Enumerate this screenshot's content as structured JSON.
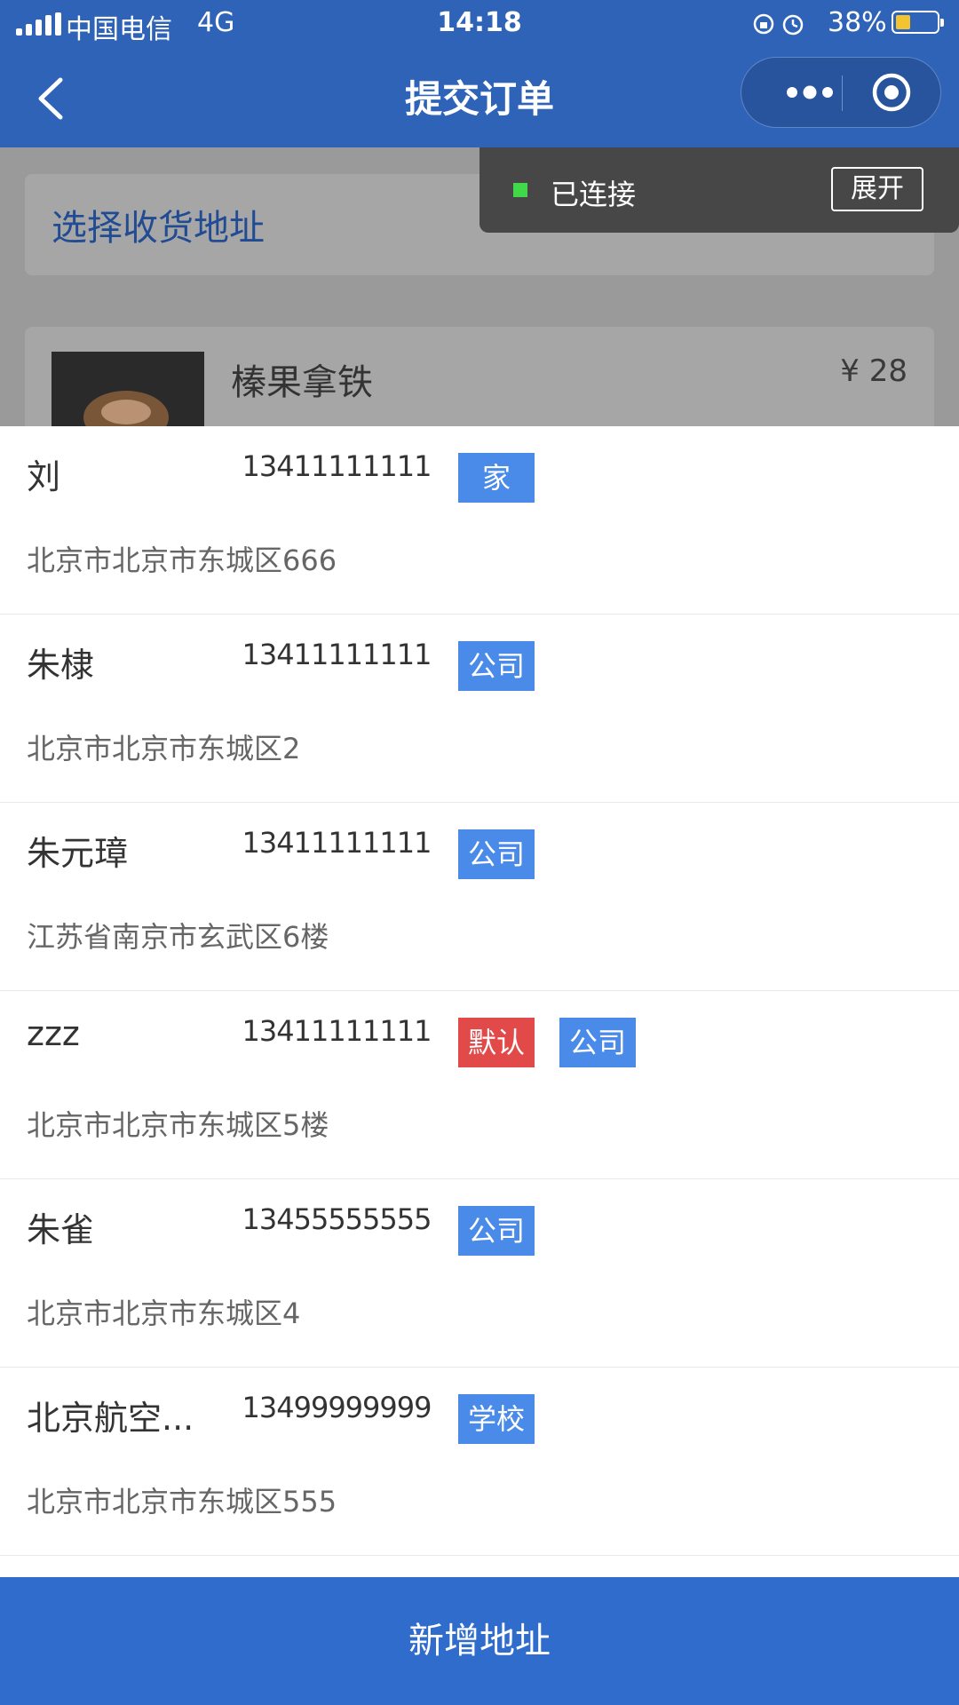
{
  "status_bar": {
    "carrier": "中国电信",
    "network": "4G",
    "time": "14:18",
    "battery": "38%"
  },
  "nav": {
    "title": "提交订单"
  },
  "colors": {
    "nav": "#2e63b8",
    "tag_blue": "#4a8ae8",
    "tag_red": "#e24a4a",
    "primary": "#2f6ccc"
  },
  "background_page": {
    "address_prompt": "选择收货地址",
    "product_name": "榛果拿铁",
    "product_price": "¥ 28"
  },
  "toast": {
    "status": "已连接",
    "expand_label": "展开"
  },
  "addresses": [
    {
      "name": "刘",
      "phone": "13411111111",
      "tags": [
        {
          "text": "家",
          "color": "#4a8ae8"
        }
      ],
      "address": "北京市北京市东城区666"
    },
    {
      "name": "朱棣",
      "phone": "13411111111",
      "tags": [
        {
          "text": "公司",
          "color": "#4a8ae8"
        }
      ],
      "address": "北京市北京市东城区2"
    },
    {
      "name": "朱元璋",
      "phone": "13411111111",
      "tags": [
        {
          "text": "公司",
          "color": "#4a8ae8"
        }
      ],
      "address": "江苏省南京市玄武区6楼"
    },
    {
      "name": "zzz",
      "phone": "13411111111",
      "tags": [
        {
          "text": "默认",
          "color": "#e24a4a"
        },
        {
          "text": "公司",
          "color": "#4a8ae8"
        }
      ],
      "address": "北京市北京市东城区5楼"
    },
    {
      "name": "朱雀",
      "phone": "13455555555",
      "tags": [
        {
          "text": "公司",
          "color": "#4a8ae8"
        }
      ],
      "address": "北京市北京市东城区4"
    },
    {
      "name": "北京航空...",
      "phone": "13499999999",
      "tags": [
        {
          "text": "学校",
          "color": "#4a8ae8"
        }
      ],
      "address": "北京市北京市东城区555"
    }
  ],
  "add_button_label": "新增地址"
}
